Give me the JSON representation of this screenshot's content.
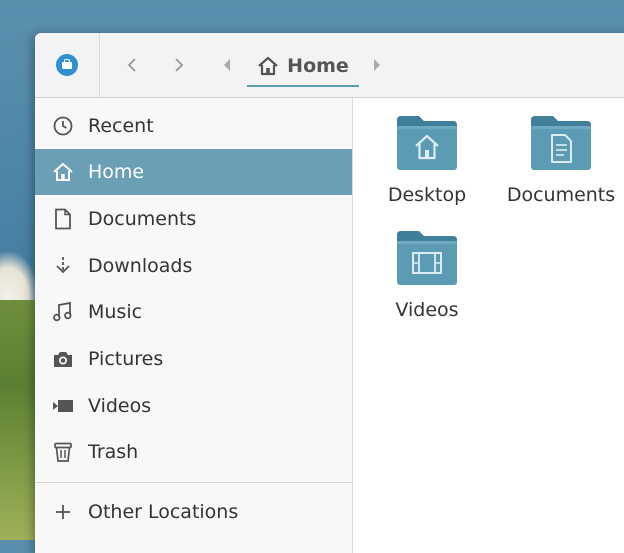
{
  "header": {
    "app_icon": "files-app-icon",
    "back_icon": "chevron-left-icon",
    "forward_icon": "chevron-right-icon",
    "breadcrumb": {
      "icon": "home-icon",
      "label": "Home"
    }
  },
  "sidebar": {
    "items": [
      {
        "label": "Recent",
        "icon": "clock-icon"
      },
      {
        "label": "Home",
        "icon": "home-icon",
        "active": true
      },
      {
        "label": "Documents",
        "icon": "document-icon"
      },
      {
        "label": "Downloads",
        "icon": "download-icon"
      },
      {
        "label": "Music",
        "icon": "music-icon"
      },
      {
        "label": "Pictures",
        "icon": "camera-icon"
      },
      {
        "label": "Videos",
        "icon": "video-icon"
      },
      {
        "label": "Trash",
        "icon": "trash-icon"
      }
    ],
    "other_locations": {
      "label": "Other Locations",
      "icon": "plus-icon"
    }
  },
  "files": [
    {
      "name": "Desktop",
      "icon": "folder-desktop-icon"
    },
    {
      "name": "Documents",
      "icon": "folder-documents-icon"
    },
    {
      "name": "Videos",
      "icon": "folder-videos-icon"
    }
  ],
  "colors": {
    "accent": "#6b9fb5",
    "folder": "#5b9bb3",
    "folder_tab": "#3f7f99",
    "app_icon": "#2f8fd0"
  }
}
